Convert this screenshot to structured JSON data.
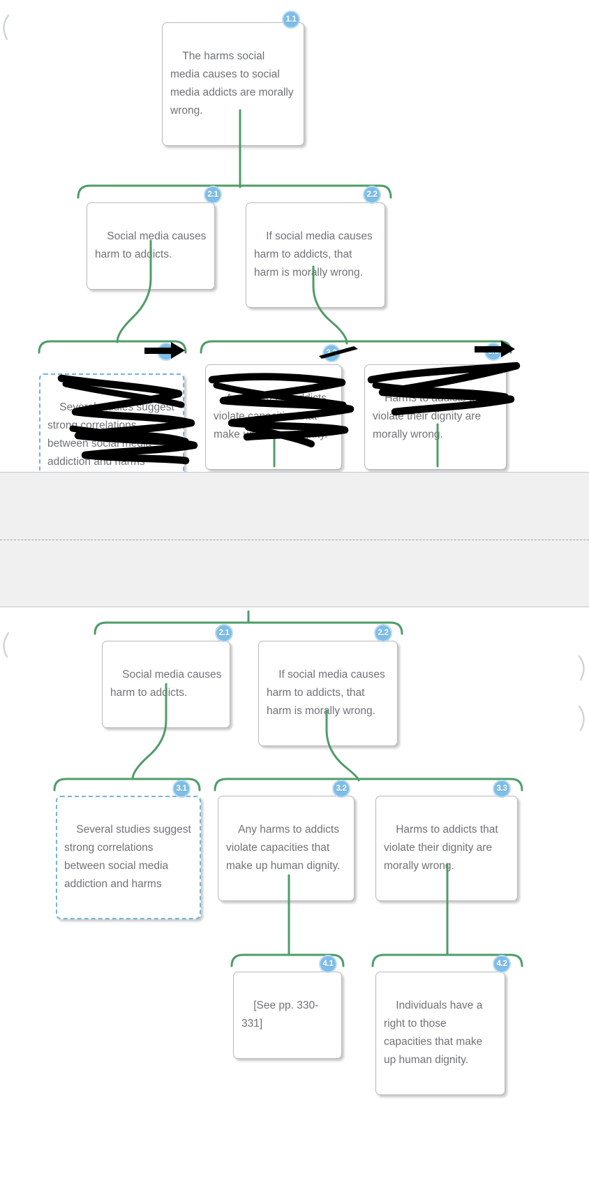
{
  "app": {
    "type": "argument-map",
    "accent_green": "#4f9c69",
    "badge_blue": "#7dbde6",
    "badge_ring": "#bcdcf2",
    "node_text_color": "#6f7276",
    "node_border": "#b9b9b9",
    "selected_border": "#74b4dd",
    "band_fill": "#f0f0f0",
    "band_edge": "#c2c6cc",
    "ink_color": "#000000"
  },
  "top_view": {
    "nodes": [
      {
        "id": "t-1-1",
        "badge": "1.1",
        "text": "The harms social media causes to social media addicts are morally wrong.",
        "selected": false,
        "obscured": false
      },
      {
        "id": "t-2-1",
        "badge": "2.1",
        "text": "Social media causes harm to addicts.",
        "selected": false,
        "obscured": false
      },
      {
        "id": "t-2-2",
        "badge": "2.2",
        "text": "If social media causes harm to addicts, that harm is morally wrong.",
        "selected": false,
        "obscured": false
      },
      {
        "id": "t-3-1",
        "badge": "3.1",
        "text": "Several studies suggest strong correlations between social media addiction and harms",
        "selected": true,
        "obscured": true
      },
      {
        "id": "t-3-2",
        "badge": "3.2",
        "text": "Any harms to addicts violate capacities that make up human dignity.",
        "selected": false,
        "obscured": true
      },
      {
        "id": "t-3-3",
        "badge": "3.3",
        "text": "Harms to addicts that violate their dignity are morally wrong.",
        "selected": false,
        "obscured": true
      }
    ]
  },
  "bottom_view": {
    "nodes": [
      {
        "id": "b-2-1",
        "badge": "2.1",
        "text": "Social media causes harm to addicts.",
        "selected": false
      },
      {
        "id": "b-2-2",
        "badge": "2.2",
        "text": "If social media causes harm to addicts, that harm is morally wrong.",
        "selected": false
      },
      {
        "id": "b-3-1",
        "badge": "3.1",
        "text": "Several studies suggest strong correlations between social media addiction and harms",
        "selected": true
      },
      {
        "id": "b-3-2",
        "badge": "3.2",
        "text": "Any harms to addicts violate capacities that make up human dignity.",
        "selected": false
      },
      {
        "id": "b-3-3",
        "badge": "3.3",
        "text": "Harms to addicts that violate their dignity are morally wrong.",
        "selected": false
      },
      {
        "id": "b-4-1",
        "badge": "4.1",
        "text": "[See pp. 330-331]",
        "selected": false
      },
      {
        "id": "b-4-2",
        "badge": "4.2",
        "text": "Individuals have a right to those capacities that make up human dignity.",
        "selected": false
      }
    ]
  },
  "annotations": {
    "scribbles": 3,
    "cursors": 3,
    "cursor_icon": "arrow-pointer-icon"
  }
}
